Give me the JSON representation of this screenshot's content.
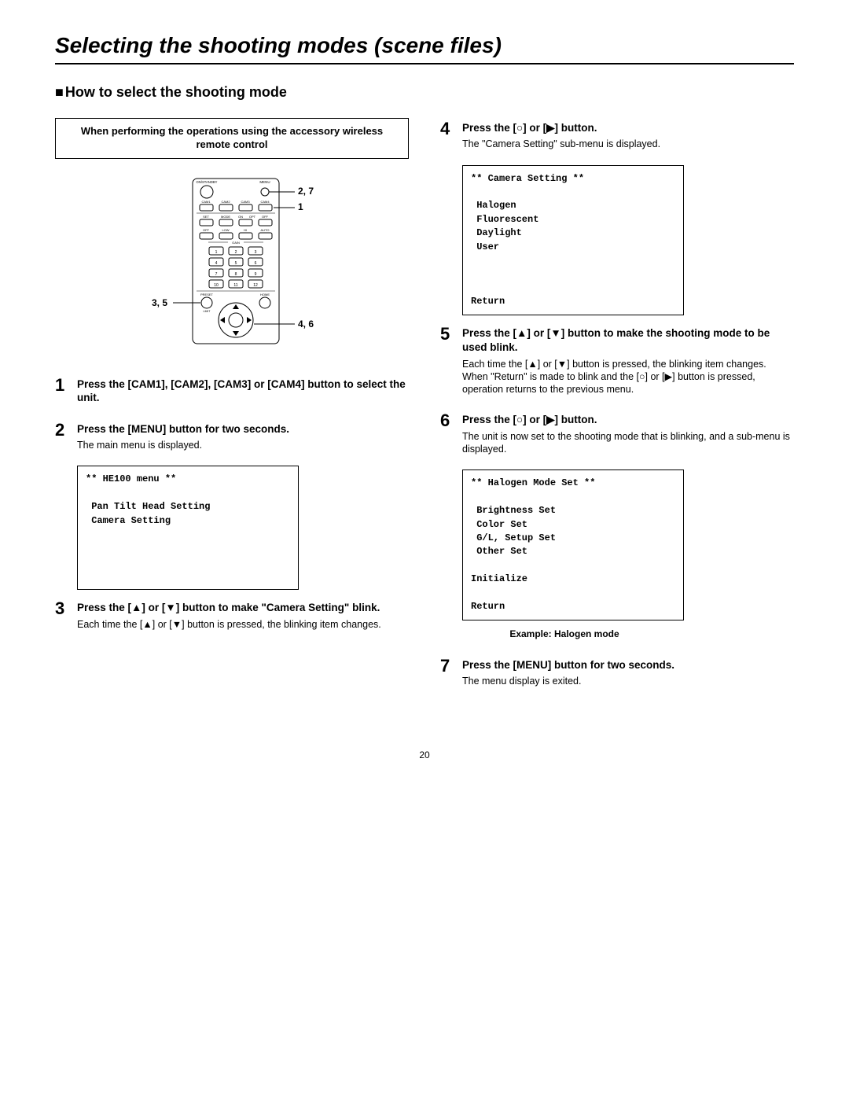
{
  "title": "Selecting the shooting modes (scene files)",
  "section": "How to select the shooting mode",
  "note": "When performing the operations using the accessory wireless remote control",
  "callouts": {
    "a": "2, 7",
    "b": "1",
    "c": "3, 5",
    "d": "4, 6"
  },
  "remote": {
    "top_left": "ON/STANDBY",
    "top_right": "MENU",
    "row_cam": [
      "CAM1",
      "CAM2",
      "CAM3",
      "CAM4"
    ],
    "row_set": [
      "SET",
      "MODE",
      "ON",
      "OFF"
    ],
    "row_set_sub": "OPT",
    "row_gain_top": [
      "OFF",
      "LOW",
      "HI",
      "AUTO"
    ],
    "gain_label": "GAIN",
    "nums": [
      "1",
      "2",
      "3",
      "4",
      "5",
      "6",
      "7",
      "8",
      "9",
      "10",
      "11",
      "12"
    ],
    "preset": "PRESET",
    "home": "HOME",
    "limit": "LIMIT"
  },
  "steps": {
    "s1": {
      "n": "1",
      "head": "Press the [CAM1], [CAM2], [CAM3] or [CAM4] button to select the unit."
    },
    "s2": {
      "n": "2",
      "head": "Press the [MENU] button for two seconds.",
      "desc": "The main menu is displayed."
    },
    "s3": {
      "n": "3",
      "head": "Press the [▲] or [▼] button to make \"Camera Setting\" blink.",
      "desc": "Each time the [▲] or [▼] button is pressed, the blinking item changes."
    },
    "s4": {
      "n": "4",
      "head": "Press the [○] or [▶] button.",
      "desc": "The \"Camera Setting\" sub-menu is displayed."
    },
    "s5": {
      "n": "5",
      "head": "Press the [▲] or [▼] button to make the shooting mode to be used blink.",
      "desc": "Each time the [▲] or [▼] button is pressed, the blinking item changes.\nWhen \"Return\" is made to blink and the [○] or [▶] button is pressed, operation returns to the previous menu."
    },
    "s6": {
      "n": "6",
      "head": "Press the [○] or [▶] button.",
      "desc": "The unit is now set to the shooting mode that is blinking, and a sub-menu is displayed."
    },
    "s7": {
      "n": "7",
      "head": "Press the [MENU] button for two seconds.",
      "desc": "The menu display is exited."
    }
  },
  "menu1_title": "** HE100 menu **",
  "menu1_items": " Pan Tilt Head Setting\n Camera Setting",
  "menu2_title": "** Camera Setting **",
  "menu2_items": " Halogen\n Fluorescent\n Daylight\n User",
  "menu2_return": "Return",
  "menu3_title": "** Halogen Mode Set **",
  "menu3_items": " Brightness Set\n Color Set\n G/L, Setup Set\n Other Set",
  "menu3_init": "Initialize",
  "menu3_return": "Return",
  "menu3_caption": "Example: Halogen mode",
  "page": "20"
}
